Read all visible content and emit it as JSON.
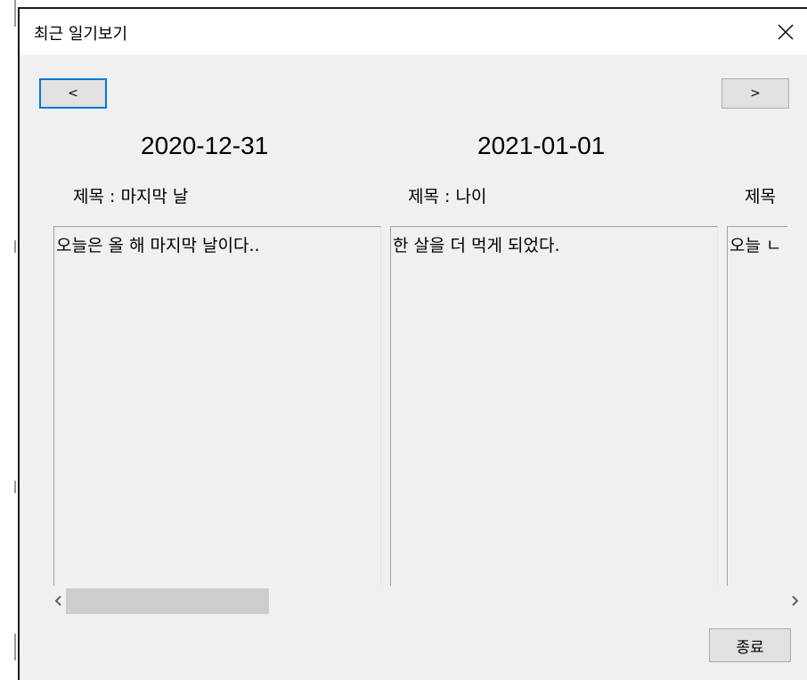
{
  "window": {
    "title": "최근 일기보기"
  },
  "nav": {
    "prev_label": "<",
    "next_label": ">"
  },
  "entries": [
    {
      "date": "2020-12-31",
      "title_label": "제목 : 마지막 날",
      "content": "오늘은 올 해 마지막 날이다.."
    },
    {
      "date": "2021-01-01",
      "title_label": "제목 : 나이",
      "content": "한 살을 더 먹게 되었다."
    },
    {
      "date": "",
      "title_label": "제목",
      "content": "오늘 ㄴ"
    }
  ],
  "footer": {
    "close_label": "종료"
  }
}
